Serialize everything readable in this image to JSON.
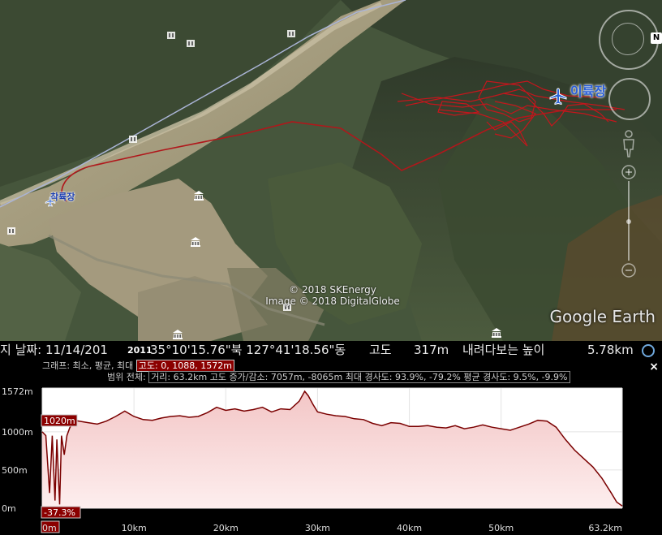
{
  "map": {
    "labels": {
      "destination": "이륙장",
      "origin": "착륙장"
    },
    "copyright": [
      "© 2018 SKEnergy",
      "Image © 2018 DigitalGlobe"
    ],
    "logo": "Google Earth",
    "compass_letter": "N"
  },
  "status_bar": {
    "date_prefix": "지 날짜: 11/14/201",
    "year_overlay": "2011",
    "coords": "35°10'15.76\"북 127°41'18.56\"동",
    "elev_label": "고도",
    "elev_value": "317m",
    "eye_label": "내려다보는 높이",
    "eye_value": "5.78km"
  },
  "profile_info": {
    "graph_label": "그래프: 최소, 평균, 최대",
    "graph_values": "고도: 0, 1088, 1572m",
    "range_label": "범위 전체:",
    "range_values": "거리: 63.2km 고도 증가/감소: 7057m, -8065m 최대 경사도: 93.9%, -79.2% 평균 경사도: 9.5%, -9.9%",
    "close": "×"
  },
  "chart_data": {
    "type": "area",
    "title": "",
    "xlabel": "",
    "ylabel": "",
    "x_unit": "km",
    "xlim": [
      0,
      63.2
    ],
    "ylim": [
      0,
      1572
    ],
    "y_ticks": [
      "1572m",
      "1000m",
      "500m",
      "0m"
    ],
    "y_tick_values": [
      1572,
      1000,
      500,
      0
    ],
    "x_ticks": [
      "0m",
      "10km",
      "20km",
      "30km",
      "40km",
      "50km",
      "63.2km"
    ],
    "x_tick_values": [
      0,
      10,
      20,
      30,
      40,
      50,
      63.2
    ],
    "cursor_elevation_label": "1020m",
    "cursor_grade_label": "-37.3%",
    "series": [
      {
        "x": [
          0,
          0.4,
          0.8,
          1.1,
          1.4,
          1.6,
          1.9,
          2.1,
          2.4,
          2.7,
          3.0,
          3.5,
          4.0,
          5.0,
          6.0,
          7.0,
          8.0,
          9.0,
          10.0,
          11.0,
          12.0,
          13.0,
          14.0,
          15.0,
          16.0,
          17.0,
          18.0,
          19.0,
          20.0,
          21.0,
          22.0,
          23.0,
          24.0,
          25.0,
          26.0,
          27.0,
          28.0,
          28.6,
          29.0,
          29.5,
          30.0,
          31.0,
          32.0,
          33.0,
          34.0,
          35.0,
          36.0,
          37.0,
          38.0,
          39.0,
          40.0,
          41.0,
          42.0,
          43.0,
          44.0,
          45.0,
          46.0,
          47.0,
          48.0,
          49.0,
          50.0,
          51.0,
          52.0,
          53.0,
          54.0,
          55.0,
          56.0,
          57.0,
          58.0,
          59.0,
          60.0,
          61.0,
          62.0,
          62.6,
          63.2
        ],
        "y": [
          1000,
          950,
          200,
          950,
          100,
          900,
          50,
          950,
          700,
          950,
          1050,
          1150,
          1140,
          1120,
          1100,
          1140,
          1200,
          1270,
          1200,
          1160,
          1150,
          1180,
          1200,
          1210,
          1190,
          1200,
          1250,
          1320,
          1280,
          1300,
          1270,
          1290,
          1320,
          1260,
          1300,
          1290,
          1400,
          1530,
          1470,
          1360,
          1260,
          1230,
          1210,
          1200,
          1170,
          1160,
          1110,
          1080,
          1120,
          1110,
          1070,
          1070,
          1080,
          1060,
          1050,
          1080,
          1040,
          1060,
          1090,
          1060,
          1040,
          1020,
          1060,
          1100,
          1150,
          1140,
          1060,
          900,
          760,
          650,
          540,
          390,
          200,
          80,
          30
        ]
      }
    ]
  }
}
